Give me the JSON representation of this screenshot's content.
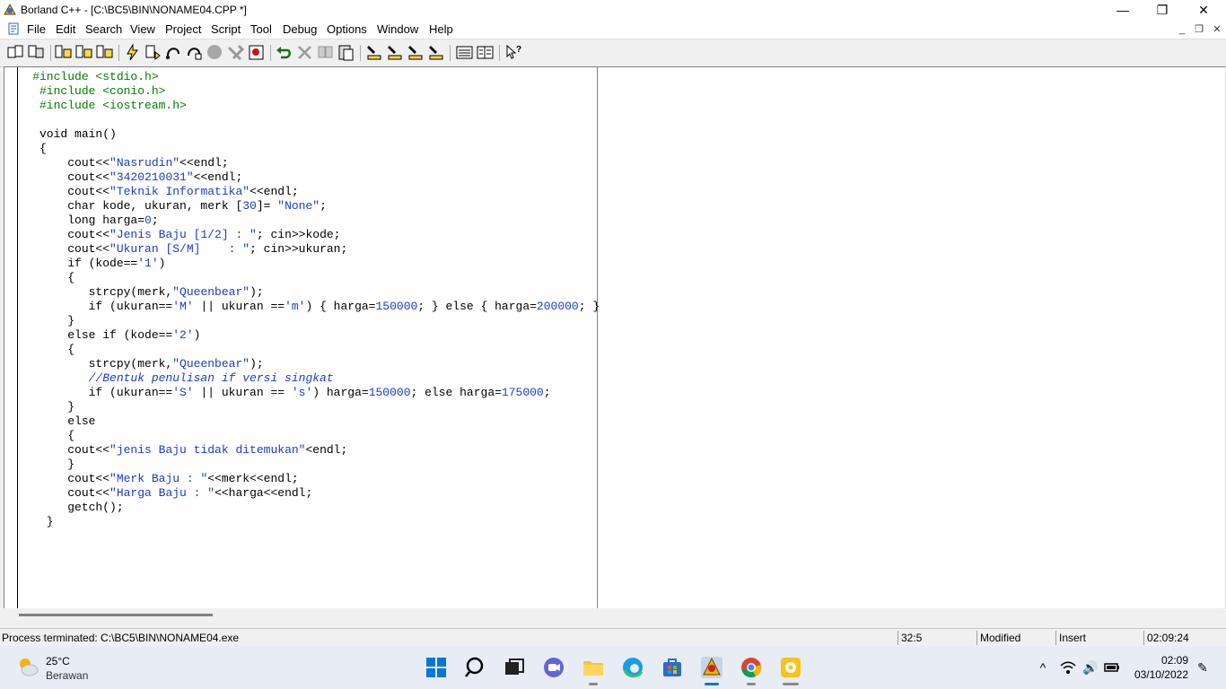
{
  "window": {
    "title": "Borland C++ - [C:\\BC5\\BIN\\NONAME04.CPP *]",
    "min_glyph": "—",
    "max_glyph": "❐",
    "close_glyph": "✕"
  },
  "menu": {
    "items": [
      "File",
      "Edit",
      "Search",
      "View",
      "Project",
      "Script",
      "Tool",
      "Debug",
      "Options",
      "Window",
      "Help"
    ],
    "mdi_min": "_",
    "mdi_restore": "❐",
    "mdi_close": "✕"
  },
  "editor": {
    "lines": [
      [
        {
          "t": "pp",
          "v": "    #include <stdio.h>"
        }
      ],
      [
        {
          "t": "pp",
          "v": "     #include <conio.h>"
        }
      ],
      [
        {
          "t": "pp",
          "v": "     #include <iostream.h>"
        }
      ],
      [
        {
          "t": "",
          "v": ""
        }
      ],
      [
        {
          "t": "",
          "v": "     void main()"
        }
      ],
      [
        {
          "t": "",
          "v": "     {"
        }
      ],
      [
        {
          "t": "",
          "v": "         cout<<"
        },
        {
          "t": "str",
          "v": "\"Nasrudin\""
        },
        {
          "t": "",
          "v": "<<endl;"
        }
      ],
      [
        {
          "t": "",
          "v": "         cout<<"
        },
        {
          "t": "str",
          "v": "\"3420210031\""
        },
        {
          "t": "",
          "v": "<<endl;"
        }
      ],
      [
        {
          "t": "",
          "v": "         cout<<"
        },
        {
          "t": "str",
          "v": "\"Teknik Informatika\""
        },
        {
          "t": "",
          "v": "<<endl;"
        }
      ],
      [
        {
          "t": "",
          "v": "         char kode, ukuran, merk ["
        },
        {
          "t": "num",
          "v": "30"
        },
        {
          "t": "",
          "v": "]= "
        },
        {
          "t": "str",
          "v": "\"None\""
        },
        {
          "t": "",
          "v": ";"
        }
      ],
      [
        {
          "t": "",
          "v": "         long harga="
        },
        {
          "t": "num",
          "v": "0"
        },
        {
          "t": "",
          "v": ";"
        }
      ],
      [
        {
          "t": "",
          "v": "         cout<<"
        },
        {
          "t": "str",
          "v": "\"Jenis Baju [1/2] : \""
        },
        {
          "t": "",
          "v": "; cin>>kode;"
        }
      ],
      [
        {
          "t": "",
          "v": "         cout<<"
        },
        {
          "t": "str",
          "v": "\"Ukuran [S/M]    : \""
        },
        {
          "t": "",
          "v": "; cin>>ukuran;"
        }
      ],
      [
        {
          "t": "",
          "v": "         if (kode=="
        },
        {
          "t": "str",
          "v": "'1'"
        },
        {
          "t": "",
          "v": ")"
        }
      ],
      [
        {
          "t": "",
          "v": "         {"
        }
      ],
      [
        {
          "t": "",
          "v": "            strcpy(merk,"
        },
        {
          "t": "str",
          "v": "\"Queenbear\""
        },
        {
          "t": "",
          "v": ");"
        }
      ],
      [
        {
          "t": "",
          "v": "            if (ukuran=="
        },
        {
          "t": "str",
          "v": "'M'"
        },
        {
          "t": "",
          "v": " || ukuran =="
        },
        {
          "t": "str",
          "v": "'m'"
        },
        {
          "t": "",
          "v": ") { harga="
        },
        {
          "t": "num",
          "v": "150000"
        },
        {
          "t": "",
          "v": "; } else { harga="
        },
        {
          "t": "num",
          "v": "200000"
        },
        {
          "t": "",
          "v": "; }"
        }
      ],
      [
        {
          "t": "",
          "v": "         }"
        }
      ],
      [
        {
          "t": "",
          "v": "         else if (kode=="
        },
        {
          "t": "str",
          "v": "'2'"
        },
        {
          "t": "",
          "v": ")"
        }
      ],
      [
        {
          "t": "",
          "v": "         {"
        }
      ],
      [
        {
          "t": "",
          "v": "            strcpy(merk,"
        },
        {
          "t": "str",
          "v": "\"Queenbear\""
        },
        {
          "t": "",
          "v": ");"
        }
      ],
      [
        {
          "t": "cm",
          "v": "            //Bentuk penulisan if versi singkat"
        }
      ],
      [
        {
          "t": "",
          "v": "            if (ukuran=="
        },
        {
          "t": "str",
          "v": "'S'"
        },
        {
          "t": "",
          "v": " || ukuran == "
        },
        {
          "t": "str",
          "v": "'s'"
        },
        {
          "t": "",
          "v": ") harga="
        },
        {
          "t": "num",
          "v": "150000"
        },
        {
          "t": "",
          "v": "; else harga="
        },
        {
          "t": "num",
          "v": "175000"
        },
        {
          "t": "",
          "v": ";"
        }
      ],
      [
        {
          "t": "",
          "v": "         }"
        }
      ],
      [
        {
          "t": "",
          "v": "         else"
        }
      ],
      [
        {
          "t": "",
          "v": "         {"
        }
      ],
      [
        {
          "t": "",
          "v": "         cout<<"
        },
        {
          "t": "str",
          "v": "\"jenis Baju tidak ditemukan\""
        },
        {
          "t": "",
          "v": "<endl;"
        }
      ],
      [
        {
          "t": "",
          "v": "         }"
        }
      ],
      [
        {
          "t": "",
          "v": "         cout<<"
        },
        {
          "t": "str",
          "v": "\"Merk Baju : \""
        },
        {
          "t": "",
          "v": "<<merk<<endl;"
        }
      ],
      [
        {
          "t": "",
          "v": "         cout<<"
        },
        {
          "t": "str",
          "v": "\"Harga Baju : \""
        },
        {
          "t": "",
          "v": "<<harga<<endl;"
        }
      ],
      [
        {
          "t": "",
          "v": "         getch();"
        }
      ],
      [
        {
          "t": "",
          "v": "      }"
        }
      ]
    ]
  },
  "status": {
    "message": "Process terminated: C:\\BC5\\BIN\\NONAME04.exe",
    "position": "32:5",
    "modified": "Modified",
    "mode": "Insert",
    "time": "02:09:24"
  },
  "taskbar": {
    "temp": "25°C",
    "weather": "Berawan",
    "clock_time": "02:09",
    "clock_date": "03/10/2022",
    "tray_chevron": "^",
    "tray_volume": "🔊",
    "tray_pen": "✎"
  },
  "colors": {
    "string": "#1a3cc8",
    "preprocessor": "#008000",
    "win_blue": "#0078d4"
  }
}
